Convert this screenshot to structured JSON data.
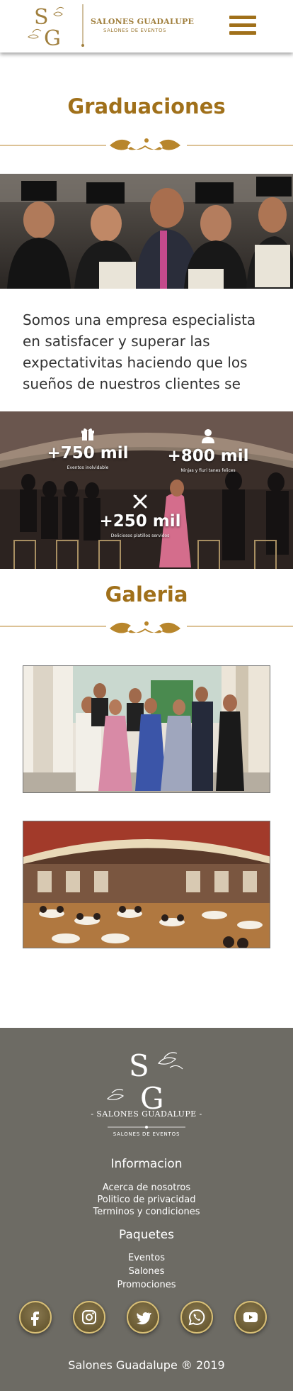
{
  "header": {
    "brand_name": "SALONES GUADALUPE",
    "brand_tagline": "SALONES DE EVENTOS",
    "menu_icon": "hamburger-menu-icon"
  },
  "graduaciones": {
    "title": "Graduaciones",
    "intro": "Somos una empresa especialista en satisfacer y superar las expectativitas haciendo que los sueños de nuestros clientes se"
  },
  "stats": [
    {
      "icon": "gift-icon",
      "value": "+750 mil",
      "caption": "Eventos inolvidable"
    },
    {
      "icon": "person-icon",
      "value": "+800 mil",
      "caption": "Ninjas y fiuri tanes felices"
    },
    {
      "icon": "utensils-icon",
      "value": "+250 mil",
      "caption": "Deliciosos platillos servidos"
    }
  ],
  "gallery": {
    "title": "Galeria"
  },
  "footer": {
    "brand_name": "- SALONES GUADALUPE -",
    "brand_tagline": "SALONES DE EVENTOS",
    "info_heading": "Informacion",
    "info_links": [
      "Acerca de nosotros",
      "Politico de privacidad",
      "Terminos y condiciones"
    ],
    "packages_heading": "Paquetes",
    "package_links": [
      "Eventos",
      "Salones",
      "Promociones"
    ],
    "social": [
      "facebook-icon",
      "instagram-icon",
      "twitter-icon",
      "whatsapp-icon",
      "youtube-icon"
    ],
    "copyright": "Salones Guadalupe ® 2019"
  },
  "colors": {
    "gold": "#a0701a",
    "footer_bg": "#6d6b64",
    "social_border": "#d8bf76"
  }
}
